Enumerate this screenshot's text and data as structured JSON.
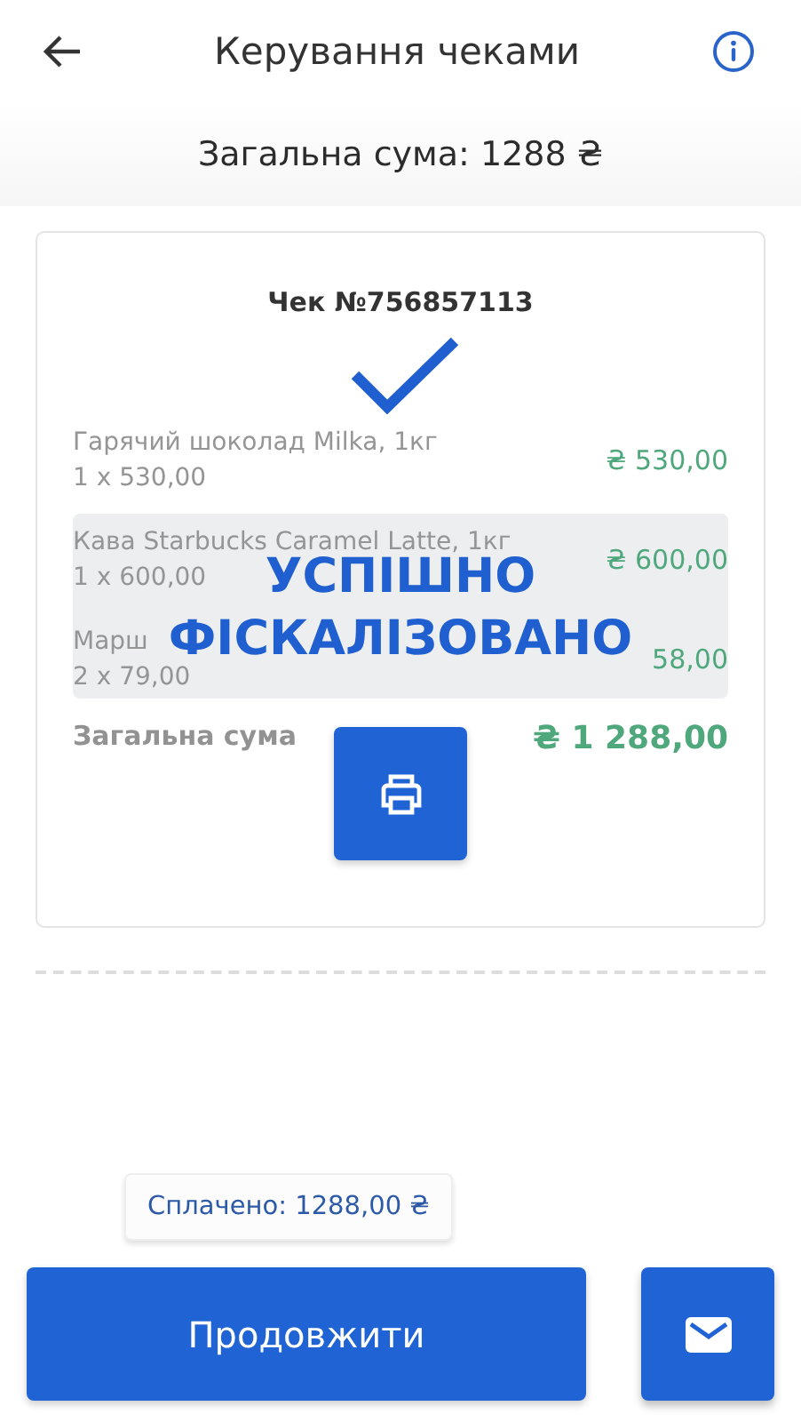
{
  "header": {
    "title": "Керування чеками"
  },
  "total_bar": {
    "text": "Загальна сума: 1288 ₴"
  },
  "receipt": {
    "number": "Чек №756857113",
    "items": [
      {
        "name": "Гарячий шоколад Milka, 1кг",
        "qty": "1 x 530,00",
        "price": "₴ 530,00"
      },
      {
        "name": "Кава Starbucks Caramel Latte, 1кг",
        "qty": "1 x 600,00",
        "price": "₴ 600,00"
      },
      {
        "name": "Марш",
        "qty": "2 x 79,00",
        "price": "58,00"
      }
    ],
    "total_label": "Загальна сума",
    "total_value": "₴ 1 288,00",
    "status": {
      "line1": "УСПІШНО",
      "line2": "ФІСКАЛІЗОВАНО"
    }
  },
  "paid_chip": "Сплачено: 1288,00 ₴",
  "continue_button": "Продовжити"
}
